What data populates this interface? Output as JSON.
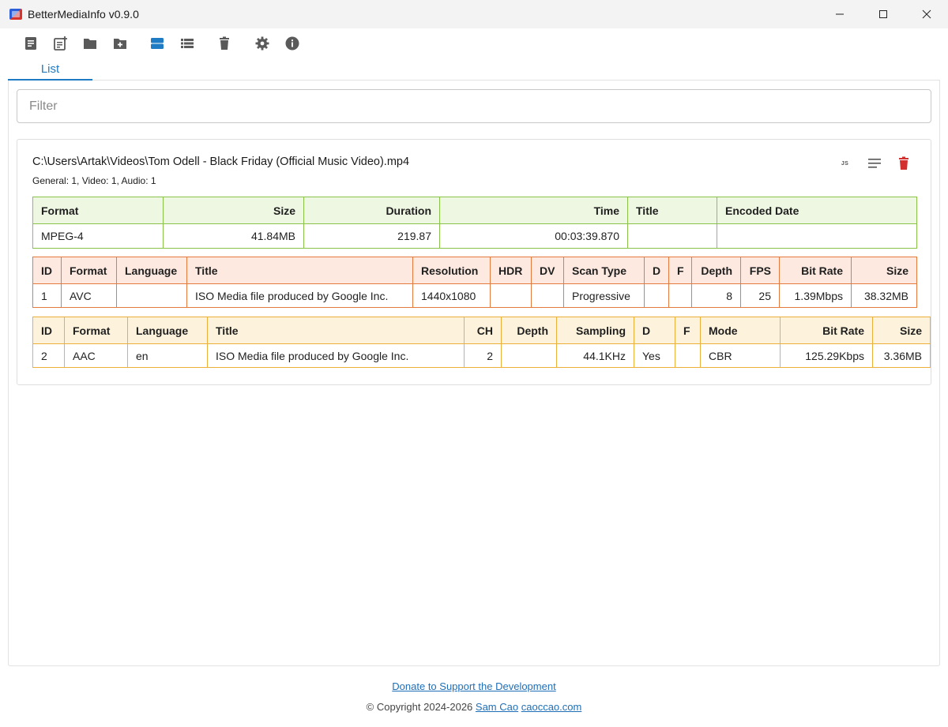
{
  "window": {
    "title": "BetterMediaInfo v0.9.0",
    "controls": {
      "minimize": "—",
      "maximize": "☐",
      "close": "✕"
    }
  },
  "toolbar": {
    "icons": [
      "open-file-icon",
      "add-file-icon",
      "open-folder-icon",
      "add-folder-icon",
      "view-cards-icon",
      "view-list-icon",
      "delete-icon",
      "settings-icon",
      "info-icon"
    ],
    "active_color": "#1e7bc4",
    "icon_color": "#5a5a5a"
  },
  "tabs": [
    {
      "label": "List",
      "active": true
    }
  ],
  "filter": {
    "placeholder": "Filter",
    "value": ""
  },
  "file": {
    "path": "C:\\Users\\Artak\\Videos\\Tom Odell - Black Friday (Official Music Video).mp4",
    "summary": "General: 1, Video: 1, Audio: 1",
    "actions": {
      "json_label": "JS"
    },
    "general": {
      "color": "#8bc34a",
      "headers": [
        "Format",
        "Size",
        "Duration",
        "Time",
        "Title",
        "Encoded Date"
      ],
      "row": [
        "MPEG-4",
        "41.84MB",
        "219.87",
        "00:03:39.870",
        "",
        ""
      ]
    },
    "video": {
      "color": "#e57a3f",
      "headers": [
        "ID",
        "Format",
        "Language",
        "Title",
        "Resolution",
        "HDR",
        "DV",
        "Scan Type",
        "D",
        "F",
        "Depth",
        "FPS",
        "Bit Rate",
        "Size"
      ],
      "row": [
        "1",
        "AVC",
        "",
        "ISO Media file produced by Google Inc.",
        "1440x1080",
        "",
        "",
        "Progressive",
        "",
        "",
        "8",
        "25",
        "1.39Mbps",
        "38.32MB"
      ]
    },
    "audio": {
      "color": "#ecb03a",
      "headers": [
        "ID",
        "Format",
        "Language",
        "Title",
        "CH",
        "Depth",
        "Sampling",
        "D",
        "F",
        "Mode",
        "Bit Rate",
        "Size"
      ],
      "row": [
        "2",
        "AAC",
        "en",
        "ISO Media file produced by Google Inc.",
        "2",
        "",
        "44.1KHz",
        "Yes",
        "",
        "CBR",
        "125.29Kbps",
        "3.36MB"
      ]
    }
  },
  "footer": {
    "donate": "Donate to Support the Development",
    "copyright_prefix": "© Copyright 2024-2026",
    "author": "Sam Cao",
    "site": "caoccao.com"
  }
}
